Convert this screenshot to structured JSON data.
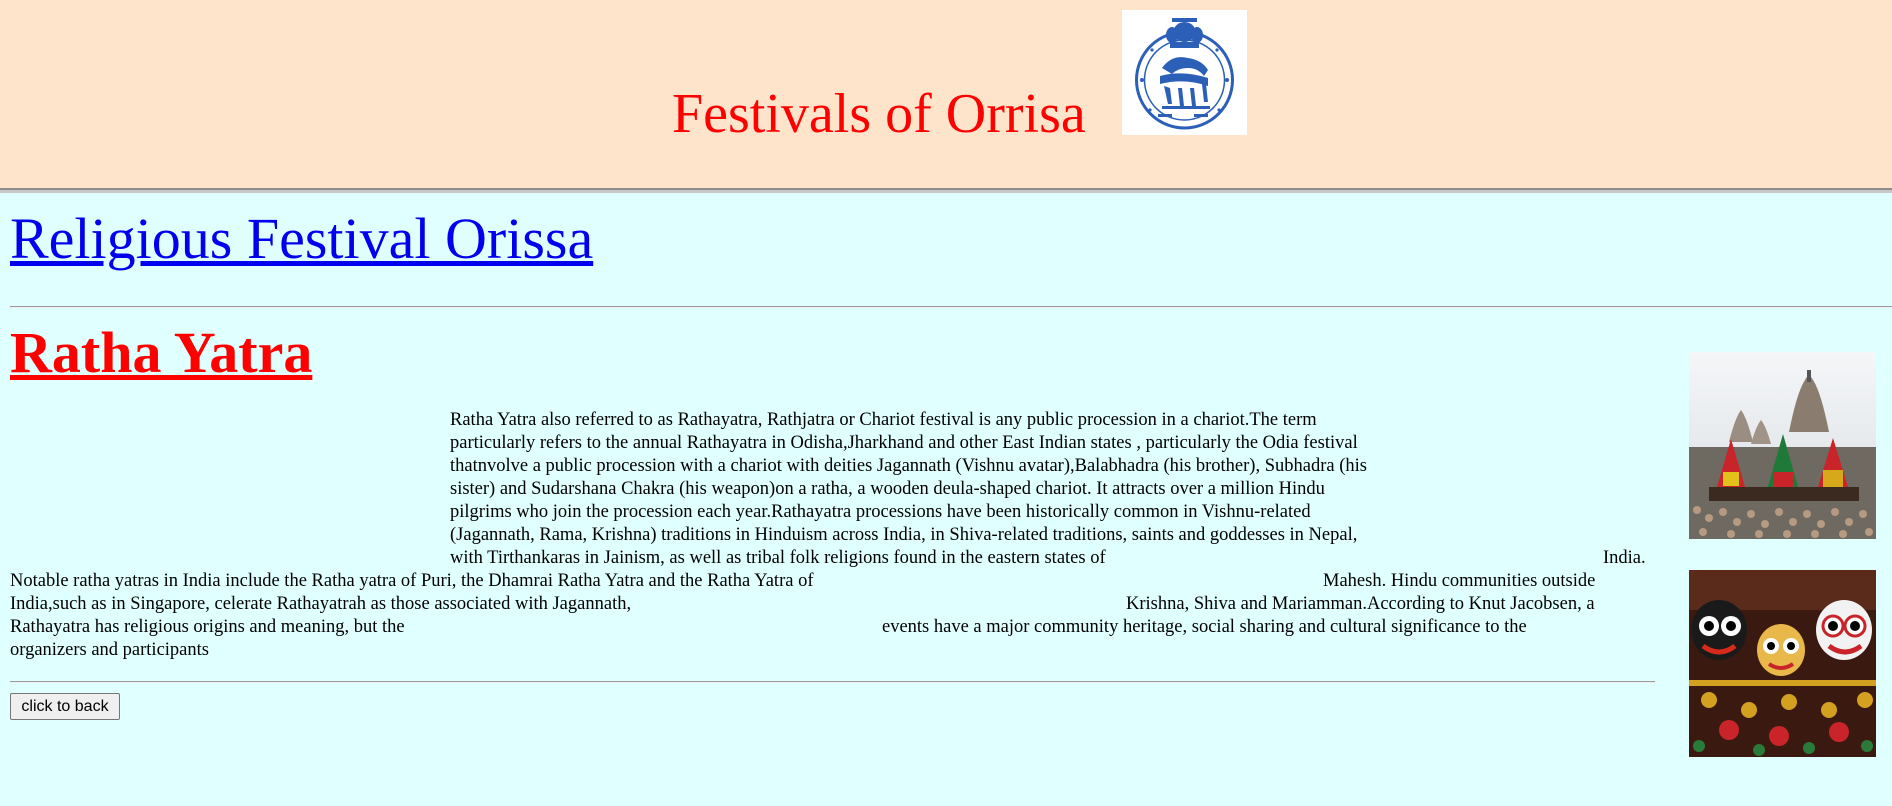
{
  "header": {
    "title": "Festivals of Orrisa",
    "emblem_icon": "odisha-state-emblem-icon"
  },
  "section_link": "Religious Festival Orissa",
  "article": {
    "title": "Ratha Yatra",
    "lines": [
      "Ratha Yatra also referred to as Rathayatra, Rathjatra or Chariot festival is any public procession in a chariot.The term",
      "particularly refers to the annual Rathayatra in Odisha,Jharkhand and other East Indian states , particularly the Odia festival",
      "thatnvolve a public procession with a chariot with deities Jagannath (Vishnu avatar),Balabhadra (his brother), Subhadra (his",
      "sister) and Sudarshana Chakra (his weapon)on a ratha, a wooden deula-shaped chariot. It attracts over a million Hindu",
      "pilgrims who join the procession each year.Rathayatra processions have been historically common in Vishnu-related",
      "(Jagannath, Rama, Krishna) traditions in Hinduism across India, in Shiva-related traditions, saints and goddesses in Nepal,",
      "with Tirthankaras in Jainism, as well as tribal folk religions found in the eastern states of",
      "India.",
      "Notable ratha yatras in India include the Ratha yatra of Puri, the Dhamrai Ratha Yatra and the Ratha Yatra of",
      "Mahesh. Hindu communities outside",
      "India,such as in Singapore, celerate Rathayatrah as those associated with Jagannath,",
      "Krishna, Shiva and Mariamman.According to Knut Jacobsen, a",
      "Rathayatra has religious origins and meaning, but the",
      "events have a major community heritage, social sharing and cultural significance to the",
      "organizers and participants"
    ]
  },
  "back_button": "click to back",
  "images": [
    "chariots-at-puri-temple-photo",
    "jagannath-deities-photo"
  ],
  "colors": {
    "header_bg": "#ffe4cc",
    "page_bg": "#e0ffff",
    "title_red": "#ff0000",
    "link_blue": "#0000ee"
  }
}
